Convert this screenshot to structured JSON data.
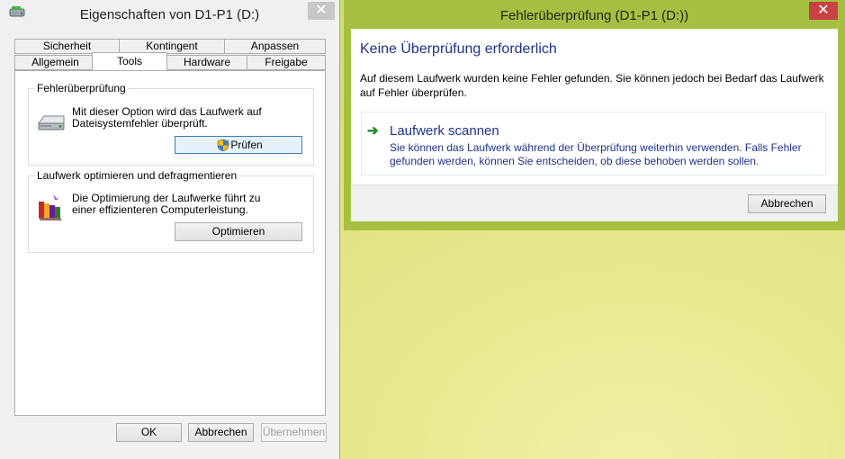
{
  "properties_window": {
    "title": "Eigenschaften von D1-P1 (D:)",
    "close_glyph": "✕",
    "tabs_row1": [
      "Sicherheit",
      "Kontingent",
      "Anpassen"
    ],
    "tabs_row2": [
      "Allgemein",
      "Tools",
      "Hardware",
      "Freigabe"
    ],
    "active_tab": "Tools",
    "error_check": {
      "group_title": "Fehlerüberprüfung",
      "description": "Mit dieser Option wird das Laufwerk auf Dateisystemfehler überprüft.",
      "button_label": "Prüfen",
      "icon": "hard-drive-icon",
      "button_icon": "uac-shield-icon"
    },
    "optimize": {
      "group_title": "Laufwerk optimieren und defragmentieren",
      "description": "Die Optimierung der Laufwerke führt zu einer effizienteren Computerleistung.",
      "button_label": "Optimieren",
      "icon": "defrag-icon"
    },
    "buttons": {
      "ok": "OK",
      "cancel": "Abbrechen",
      "apply": "Übernehmen"
    }
  },
  "check_window": {
    "title": "Fehlerüberprüfung (D1-P1 (D:))",
    "close_glyph": "✕",
    "heading": "Keine Überprüfung erforderlich",
    "description": "Auf diesem Laufwerk wurden keine Fehler gefunden. Sie können jedoch bei Bedarf das Laufwerk auf Fehler überprüfen.",
    "scan_link": {
      "title": "Laufwerk scannen",
      "description": "Sie können das Laufwerk während der Überprüfung weiterhin verwenden. Falls Fehler gefunden werden, können Sie entscheiden, ob diese behoben werden sollen.",
      "icon": "green-arrow-icon"
    },
    "cancel_label": "Abbrechen",
    "accent_color": "#a5c040",
    "close_color": "#c74343"
  }
}
